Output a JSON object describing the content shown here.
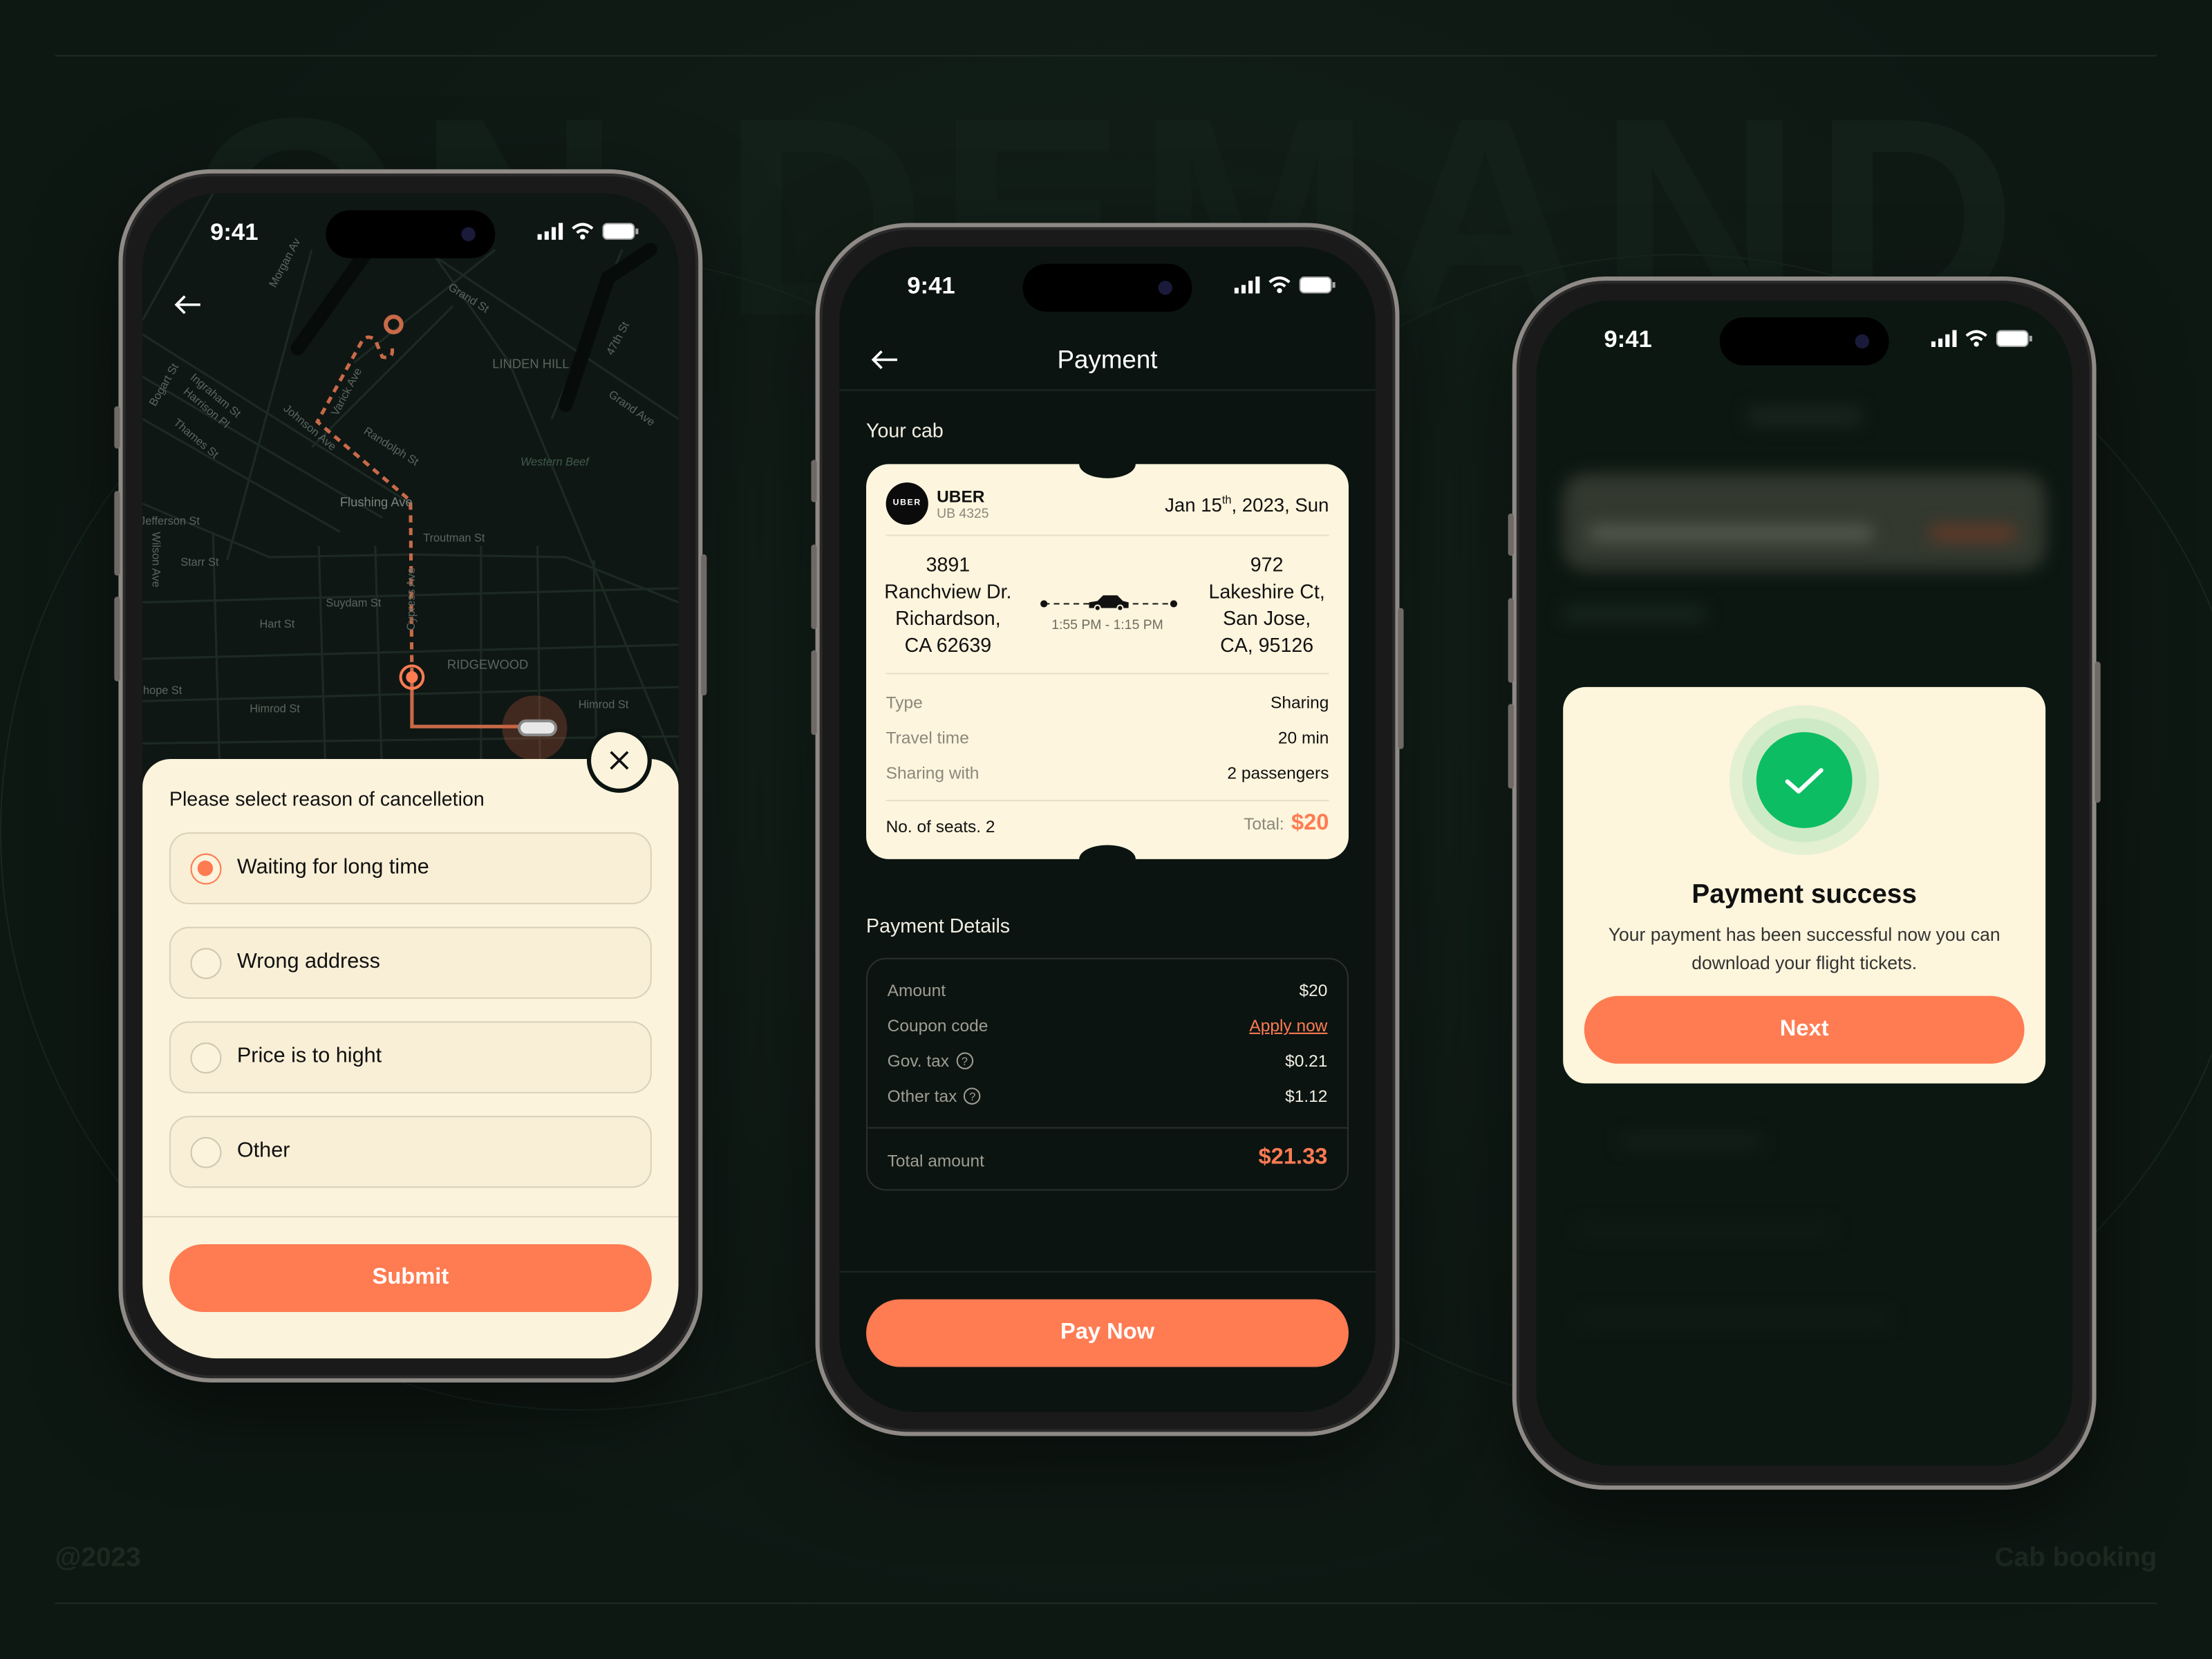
{
  "background": {
    "watermark": "ON DEMAND",
    "footer_left": "@2023",
    "footer_right": "Cab booking",
    "color": "#0f1a15"
  },
  "colors": {
    "accent": "#ff7b52",
    "cream": "#fbf3dc",
    "success": "#0dbd63",
    "screen_bg": "#0b1411"
  },
  "status_bar": {
    "time": "9:41",
    "icons": [
      "signal-icon",
      "wifi-icon",
      "battery-icon"
    ]
  },
  "cancel_screen": {
    "map_labels": [
      "Grand St",
      "LINDEN HILL",
      "47th St",
      "Grand Ave",
      "Bogart St",
      "Ingraham St",
      "Harrison Pl",
      "Thames St",
      "Johnson Ave",
      "Varick Ave",
      "Randolph St",
      "Western Beef",
      "Flushing Ave",
      "Jefferson St",
      "Wilson Ave",
      "Troutman St",
      "Starr St",
      "Suydam St",
      "Hart St",
      "Cypress Ave",
      "RIDGEWOOD",
      "Stanhope St",
      "Himrod St",
      "Himrod St",
      "Morgan Av"
    ],
    "title": "Please select reason of cancelletion",
    "options": [
      {
        "label": "Waiting for long time",
        "selected": true
      },
      {
        "label": "Wrong address",
        "selected": false
      },
      {
        "label": "Price is to hight",
        "selected": false
      },
      {
        "label": "Other",
        "selected": false
      }
    ],
    "submit_label": "Submit"
  },
  "payment_screen": {
    "title": "Payment",
    "your_cab_label": "Your cab",
    "ticket": {
      "logo_text": "UBER",
      "provider": "UBER",
      "code": "UB 4325",
      "date_prefix": "Jan 15",
      "date_sup": "th",
      "date_suffix": ", 2023, Sun",
      "from": [
        "3891",
        "Ranchview Dr.",
        "Richardson,",
        "CA 62639"
      ],
      "to": [
        "972",
        "Lakeshire Ct,",
        "San Jose,",
        "CA, 95126"
      ],
      "time_range": "1:55 PM - 1:15 PM",
      "rows": [
        {
          "label": "Type",
          "value": "Sharing"
        },
        {
          "label": "Travel time",
          "value": "20 min"
        },
        {
          "label": "Sharing with",
          "value": "2 passengers"
        }
      ],
      "seats": "No. of seats. 2",
      "total_label": "Total:",
      "total_value": "$20"
    },
    "details_title": "Payment Details",
    "details": {
      "amount_label": "Amount",
      "amount_value": "$20",
      "coupon_label": "Coupon code",
      "coupon_action": "Apply now",
      "gov_tax_label": "Gov. tax",
      "gov_tax_value": "$0.21",
      "other_tax_label": "Other tax",
      "other_tax_value": "$1.12",
      "total_label": "Total amount",
      "total_value": "$21.33",
      "help_glyph": "?"
    },
    "pay_label": "Pay Now"
  },
  "success_screen": {
    "title": "Payment success",
    "message": "Your payment has been successful now you can download your flight tickets.",
    "next_label": "Next"
  }
}
